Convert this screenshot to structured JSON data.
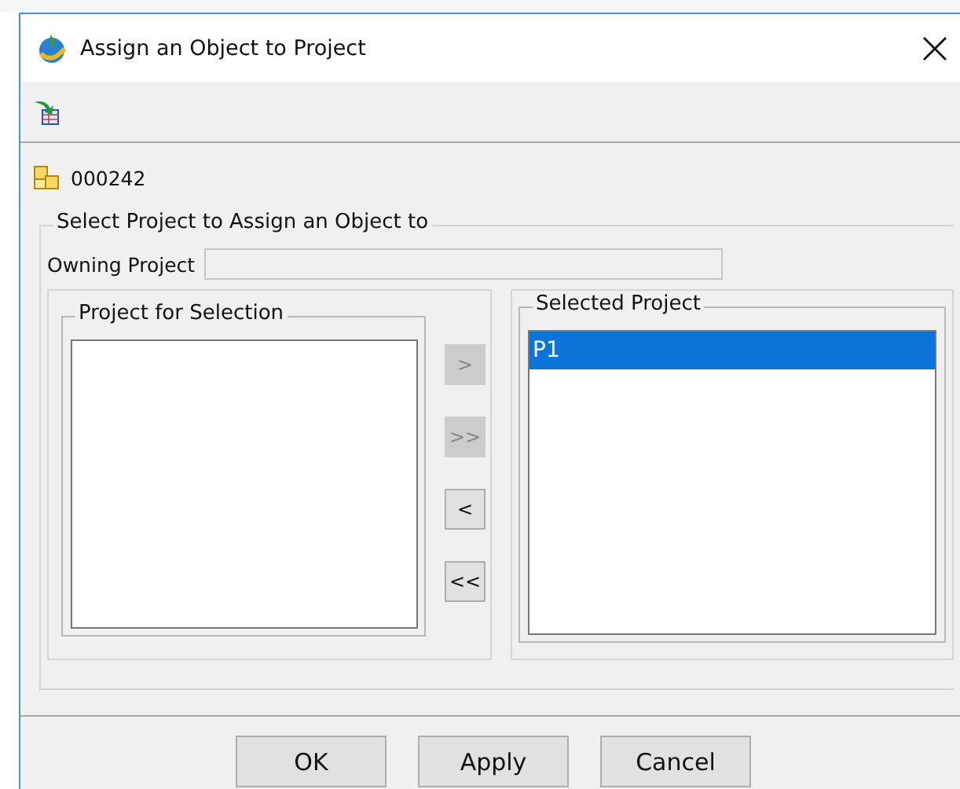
{
  "window": {
    "title": "Assign an Object to Project"
  },
  "object": {
    "id": "000242"
  },
  "group": {
    "title": "Select Project to Assign an Object to",
    "owning_project": {
      "label": "Owning Project"
    },
    "available": {
      "title": "Project for Selection"
    },
    "transfer_buttons": [
      {
        "label": ">",
        "disabled": true
      },
      {
        "label": ">>",
        "disabled": true
      },
      {
        "label": "<",
        "disabled": false
      },
      {
        "label": "<<",
        "disabled": false
      }
    ],
    "selected": {
      "title": "Selected Project",
      "items": [
        {
          "label": "P1",
          "selected": true
        }
      ]
    }
  },
  "buttons": [
    "OK",
    "Apply",
    "Cancel"
  ]
}
